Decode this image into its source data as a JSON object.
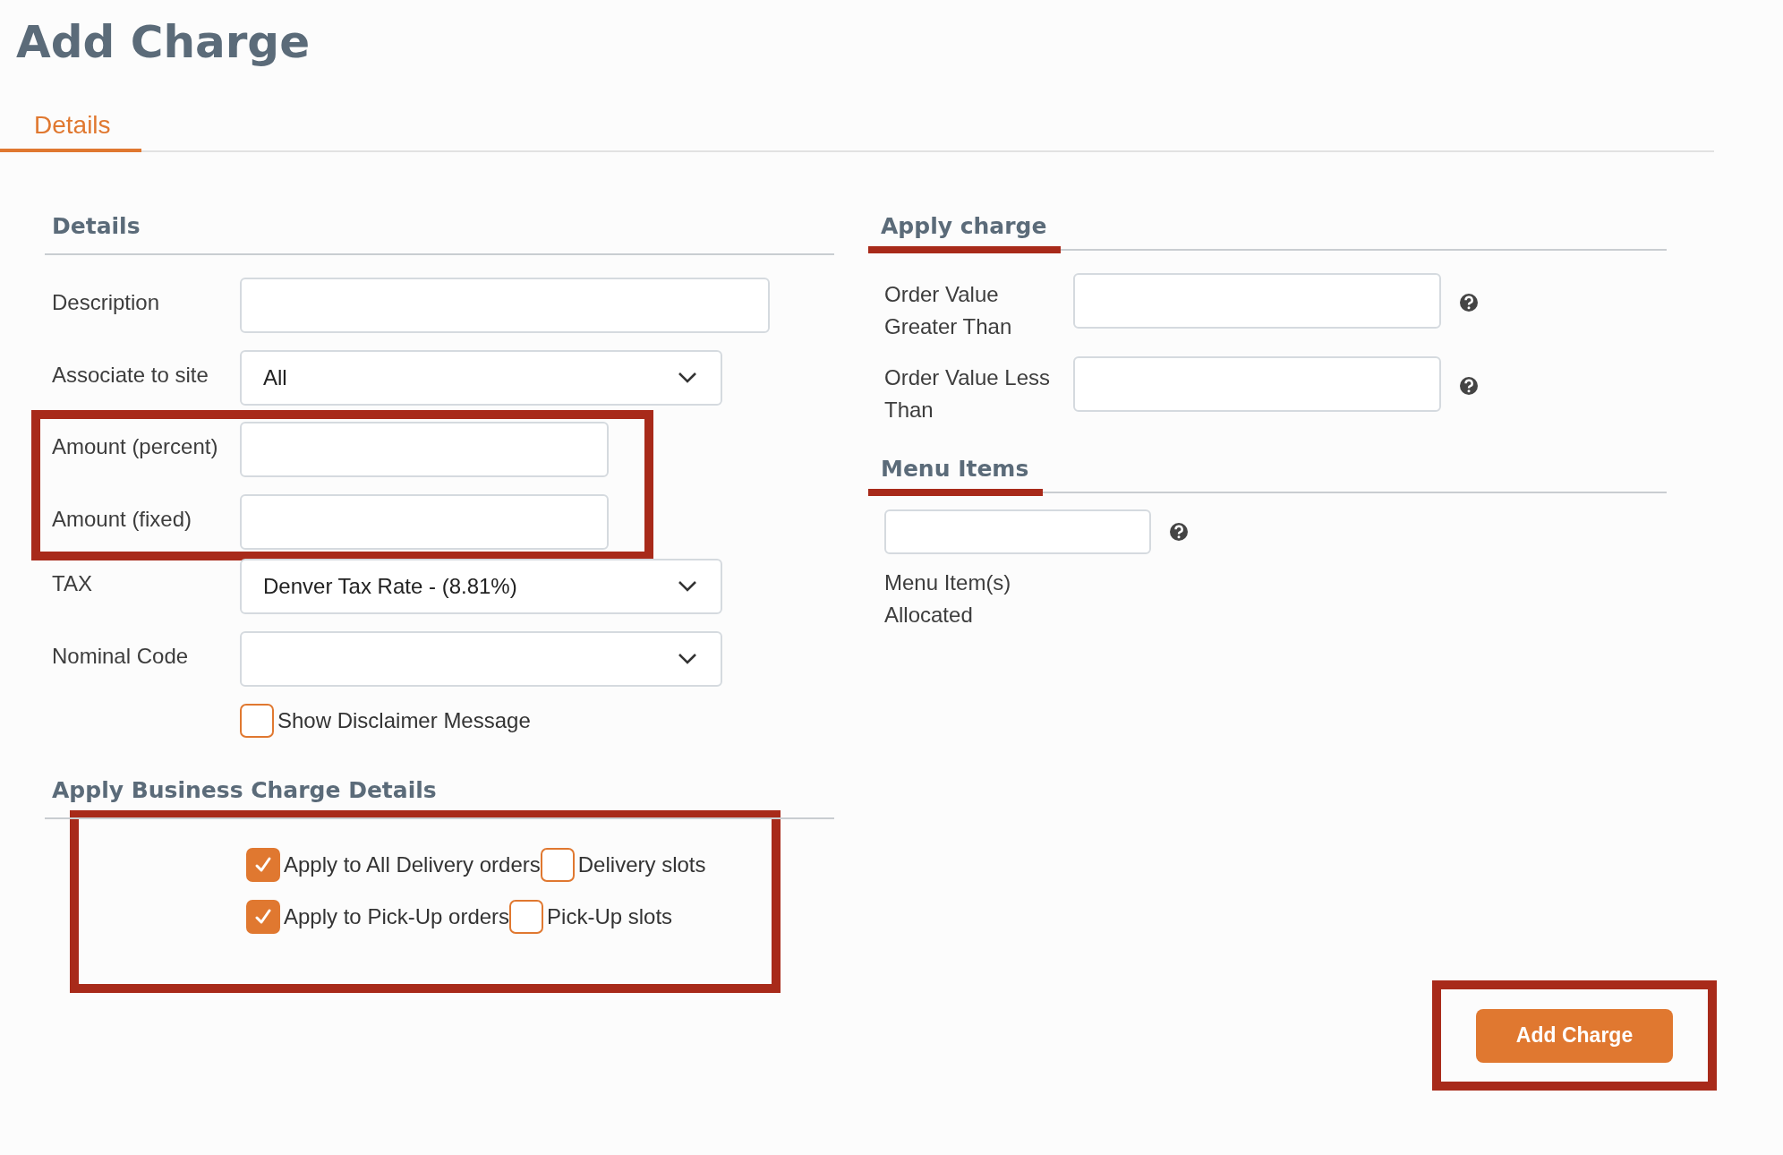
{
  "page_title": "Add Charge",
  "tabs": [
    {
      "label": "Details",
      "selected": true
    }
  ],
  "details": {
    "heading": "Details",
    "fields": [
      {
        "kind": "text",
        "label": "Description",
        "highlighted": false
      },
      {
        "kind": "select",
        "label": "Associate to site",
        "value": "All",
        "highlighted": false
      },
      {
        "kind": "text",
        "label": "Amount (percent)",
        "highlighted": true
      },
      {
        "kind": "text",
        "label": "Amount (fixed)",
        "highlighted": true
      },
      {
        "kind": "select",
        "label": "TAX",
        "value": "Denver Tax Rate - (8.81%)",
        "highlighted": false
      },
      {
        "kind": "select",
        "label": "Nominal Code",
        "highlighted": false
      },
      {
        "kind": "checkbox",
        "label": "Show Disclaimer Message",
        "checked": false,
        "highlighted": false
      }
    ]
  },
  "business_charge": {
    "heading": "Apply Business Charge Details",
    "highlighted": true,
    "rows": [
      [
        {
          "label": "Apply to All Delivery orders",
          "checked": true
        },
        {
          "label": "Delivery slots",
          "checked": false
        }
      ],
      [
        {
          "label": "Apply to Pick-Up orders",
          "checked": true
        },
        {
          "label": "Pick-Up slots",
          "checked": false
        }
      ]
    ]
  },
  "apply_charge": {
    "heading": "Apply charge",
    "fields": [
      {
        "label": "Order Value Greater Than",
        "help": true
      },
      {
        "label": "Order Value Less Than",
        "help": true
      }
    ]
  },
  "menu_items": {
    "heading": "Menu Items",
    "help": true,
    "caption": "Menu Item(s) Allocated"
  },
  "submit": {
    "label": "Add Charge",
    "highlighted": true
  }
}
